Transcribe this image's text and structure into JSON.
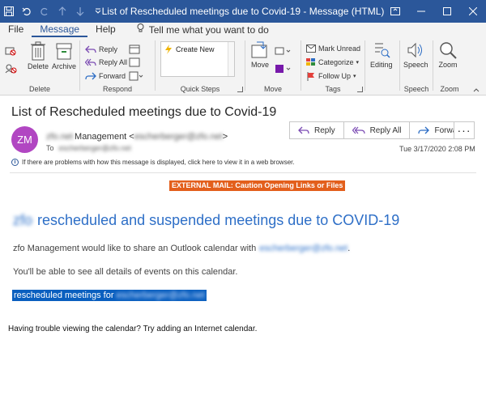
{
  "window": {
    "title": "List of Rescheduled meetings due to Covid-19  -  Message (HTML)"
  },
  "menu": {
    "tabs": [
      "File",
      "Message",
      "Help"
    ],
    "tell_me": "Tell me what you want to do"
  },
  "ribbon": {
    "delete_group": {
      "label": "Delete",
      "delete": "Delete",
      "archive": "Archive"
    },
    "respond_group": {
      "label": "Respond",
      "reply": "Reply",
      "reply_all": "Reply All",
      "forward": "Forward"
    },
    "quick_steps_group": {
      "label": "Quick Steps",
      "create_new": "Create New"
    },
    "move_group": {
      "label": "Move",
      "move": "Move"
    },
    "tags_group": {
      "label": "Tags",
      "mark_unread": "Mark Unread",
      "categorize": "Categorize",
      "follow_up": "Follow Up"
    },
    "editing_group": {
      "editing": "Editing"
    },
    "speech_group": {
      "label": "Speech",
      "speech": "Speech"
    },
    "zoom_group": {
      "label": "Zoom",
      "zoom": "Zoom"
    }
  },
  "message": {
    "subject": "List of Rescheduled meetings due to Covid-19",
    "avatar_initials": "ZM",
    "from_org": "zfo.net",
    "from_name": "Management",
    "from_email": "escherberger@zfo.net",
    "to_label": "To",
    "to_address": "escherberger@zfo.net",
    "timestamp": "Tue 3/17/2020 2:08 PM",
    "info_bar": "If there are problems with how this message is displayed, click here to view it in a web browser.",
    "actions": {
      "reply": "Reply",
      "reply_all": "Reply All",
      "forward": "Forward",
      "more": "···"
    }
  },
  "body": {
    "banner": "EXTERNAL MAIL: Caution Opening Links or Files",
    "heading_org": "zfo",
    "heading": "rescheduled and suspended meetings due to COVID-19",
    "p1_prefix": "zfo Management would like to share an Outlook calendar with",
    "p1_email": "escherberger@zfo.net",
    "p1_suffix": ".",
    "p2": "You'll be able to see all details of events on this calendar.",
    "link_prefix": "rescheduled meetings for",
    "link_email": "escherberger@zfo.net",
    "p3": "Having trouble viewing the calendar? Try adding an Internet calendar."
  },
  "colors": {
    "titlebar": "#2b579a",
    "avatar": "#b146c2",
    "banner": "#e35f1c",
    "heading": "#2e6fc7",
    "selection": "#0a5fbf"
  }
}
